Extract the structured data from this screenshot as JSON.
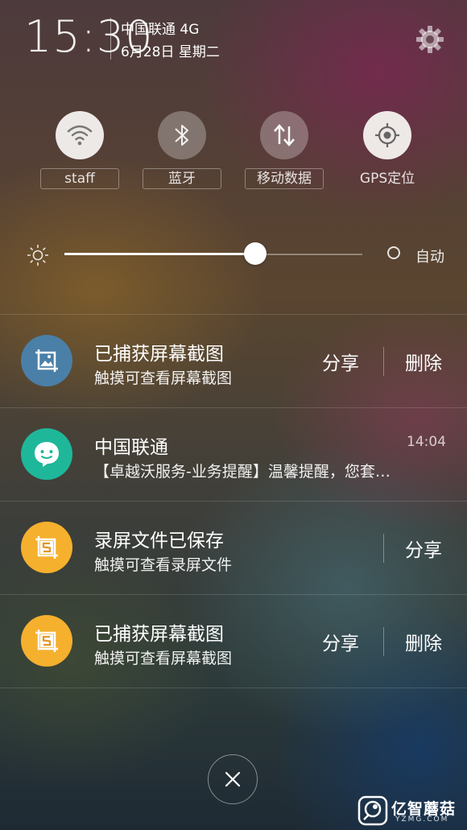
{
  "status": {
    "time": "15:30",
    "carrier": "中国联通 4G",
    "date": "6月28日 星期二"
  },
  "toggles": [
    {
      "label": "staff",
      "icon": "wifi-icon",
      "state": "on"
    },
    {
      "label": "蓝牙",
      "icon": "bluetooth-icon",
      "state": "off"
    },
    {
      "label": "移动数据",
      "icon": "mobile-data-icon",
      "state": "off"
    },
    {
      "label": "GPS定位",
      "icon": "gps-icon",
      "state": "on"
    }
  ],
  "brightness": {
    "level": 0.64,
    "auto_label": "自动",
    "auto_enabled": false
  },
  "notifications": [
    {
      "title": "已捕获屏幕截图",
      "text": "触摸可查看屏幕截图",
      "icon": "screenshot-icon",
      "icon_color": "#4a7fa8",
      "actions": [
        "分享",
        "删除"
      ]
    },
    {
      "title": "中国联通",
      "text": "【卓越沃服务-业务提醒】温馨提醒，您套…",
      "time": "14:04",
      "icon": "message-icon",
      "icon_color": "#1fb79a"
    },
    {
      "title": "录屏文件已保存",
      "text": "触摸可查看录屏文件",
      "icon": "screen-record-icon",
      "icon_color": "#f5b02e",
      "actions": [
        "分享"
      ]
    },
    {
      "title": "已捕获屏幕截图",
      "text": "触摸可查看屏幕截图",
      "icon": "screenshot-crop-icon",
      "icon_color": "#f5b02e",
      "actions": [
        "分享",
        "删除"
      ]
    }
  ],
  "watermark": {
    "brand": "亿智蘑菇",
    "domain": "YZMG.COM"
  }
}
